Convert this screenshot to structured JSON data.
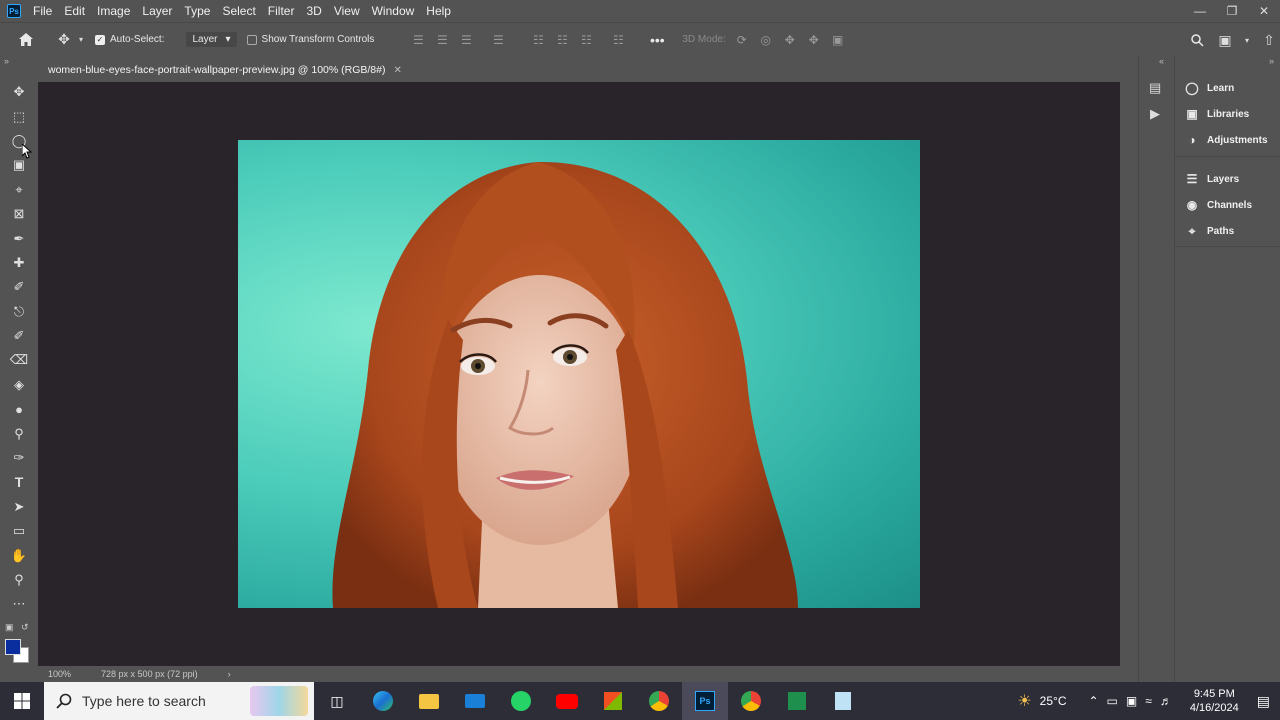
{
  "menubar": {
    "logo": "Ps",
    "items": [
      "File",
      "Edit",
      "Image",
      "Layer",
      "Type",
      "Select",
      "Filter",
      "3D",
      "View",
      "Window",
      "Help"
    ]
  },
  "options": {
    "auto_select_label": "Auto-Select:",
    "auto_select_value": "Layer",
    "show_transform_label": "Show Transform Controls",
    "mode_3d_label": "3D Mode:"
  },
  "document": {
    "tab_title": "women-blue-eyes-face-portrait-wallpaper-preview.jpg @ 100% (RGB/8#)",
    "zoom": "100%",
    "info": "728 px x 500 px (72 ppi)"
  },
  "colors": {
    "foreground": "#0a2e9e",
    "background": "#ffffff"
  },
  "panels": {
    "items": [
      {
        "label": "Learn",
        "icon": "lightbulb-icon"
      },
      {
        "label": "Libraries",
        "icon": "libraries-icon"
      },
      {
        "label": "Adjustments",
        "icon": "adjustments-icon"
      },
      {
        "label": "Layers",
        "icon": "layers-icon"
      },
      {
        "label": "Channels",
        "icon": "channels-icon"
      },
      {
        "label": "Paths",
        "icon": "paths-icon"
      }
    ]
  },
  "taskbar": {
    "search_placeholder": "Type here to search",
    "weather": "25°C",
    "time": "9:45 PM",
    "date": "4/16/2024"
  }
}
